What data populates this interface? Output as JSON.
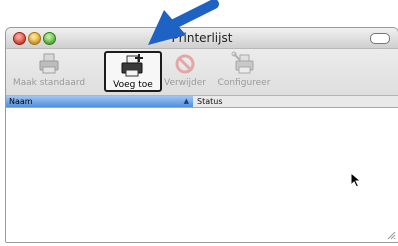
{
  "window": {
    "title": "Printerlijst"
  },
  "toolbar": {
    "buttons": [
      {
        "label": "Maak standaard",
        "icon": "printer-default-icon"
      },
      {
        "label": "Voeg toe",
        "icon": "add-printer-icon",
        "state": "highlighted"
      },
      {
        "label": "Verwijder",
        "icon": "delete-icon"
      },
      {
        "label": "Configureer",
        "icon": "configure-icon"
      }
    ]
  },
  "table": {
    "columns": [
      "Naam",
      "Status"
    ],
    "sorted_column": "Naam",
    "rows": []
  },
  "colors": {
    "header_selected": "#5f9be6",
    "annotation_arrow": "#1e63c3"
  }
}
